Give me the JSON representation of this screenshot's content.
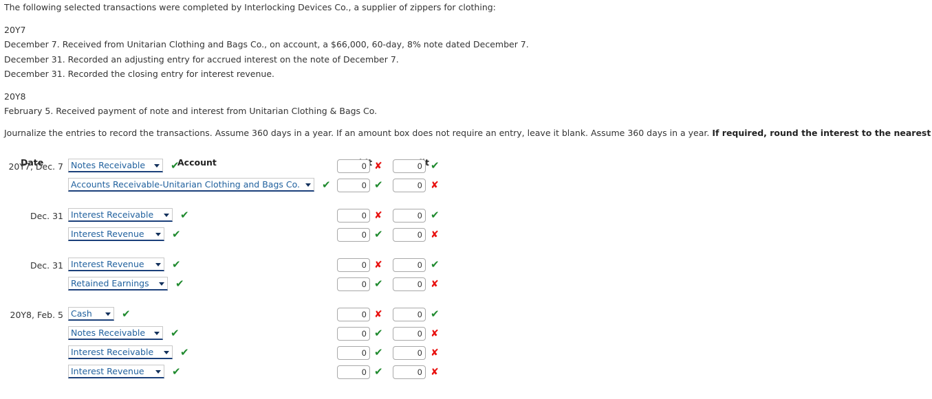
{
  "intro": {
    "lead": "The following selected transactions were completed by Interlocking Devices Co., a supplier of zippers for clothing:",
    "year_1": "20Y7",
    "y1_lines": [
      "December 7. Received from Unitarian Clothing and Bags Co., on account, a $66,000, 60-day, 8% note dated December 7.",
      "December 31. Recorded an adjusting entry for accrued interest on the note of December 7.",
      "December 31. Recorded the closing entry for interest revenue."
    ],
    "year_2": "20Y8",
    "y2_lines": [
      "February 5. Received payment of note and interest from Unitarian Clothing & Bags Co."
    ]
  },
  "instruction": {
    "normal": "Journalize the entries to record the transactions. Assume 360 days in a year. If an amount box does not require an entry, leave it blank. Assume 360 days in a year. ",
    "bold": "If required, round the interest to the nearest cent."
  },
  "headers": {
    "date": "Date",
    "account": "Account",
    "debit": "Debit",
    "credit": "Credit"
  },
  "marks": {
    "correct": "✔",
    "incorrect": "✘"
  },
  "colors": {
    "correct": "#1f8a2e",
    "incorrect": "#e8110f",
    "select_text": "#21619e",
    "select_underline": "#1a3f7a",
    "body_text": "#333333"
  },
  "amount_placeholder": "",
  "groups": [
    {
      "date": "20Y7, Dec. 7",
      "rows": [
        {
          "account": "Notes Receivable",
          "account_width": 138,
          "account_status": "correct",
          "debit_value": "0",
          "debit_status": "incorrect",
          "credit_value": "0",
          "credit_status": "correct"
        },
        {
          "account": "Accounts Receivable-Unitarian Clothing and Bags Co.",
          "account_width": 358,
          "account_status": "correct",
          "debit_value": "0",
          "debit_status": "correct",
          "credit_value": "0",
          "credit_status": "incorrect"
        }
      ]
    },
    {
      "date": "Dec. 31",
      "rows": [
        {
          "account": "Interest Receivable",
          "account_width": 152,
          "account_status": "correct",
          "debit_value": "0",
          "debit_status": "incorrect",
          "credit_value": "0",
          "credit_status": "correct"
        },
        {
          "account": "Interest Revenue",
          "account_width": 140,
          "account_status": "correct",
          "debit_value": "0",
          "debit_status": "correct",
          "credit_value": "0",
          "credit_status": "incorrect"
        }
      ]
    },
    {
      "date": "Dec. 31",
      "rows": [
        {
          "account": "Interest Revenue",
          "account_width": 140,
          "account_status": "correct",
          "debit_value": "0",
          "debit_status": "incorrect",
          "credit_value": "0",
          "credit_status": "correct"
        },
        {
          "account": "Retained Earnings",
          "account_width": 145,
          "account_status": "correct",
          "debit_value": "0",
          "debit_status": "correct",
          "credit_value": "0",
          "credit_status": "incorrect"
        }
      ]
    },
    {
      "date": "20Y8, Feb. 5",
      "rows": [
        {
          "account": "Cash",
          "account_width": 67,
          "account_status": "correct",
          "debit_value": "0",
          "debit_status": "incorrect",
          "credit_value": "0",
          "credit_status": "correct"
        },
        {
          "account": "Notes Receivable",
          "account_width": 138,
          "account_status": "correct",
          "debit_value": "0",
          "debit_status": "correct",
          "credit_value": "0",
          "credit_status": "incorrect"
        },
        {
          "account": "Interest Receivable",
          "account_width": 152,
          "account_status": "correct",
          "debit_value": "0",
          "debit_status": "correct",
          "credit_value": "0",
          "credit_status": "incorrect"
        },
        {
          "account": "Interest Revenue",
          "account_width": 140,
          "account_status": "correct",
          "debit_value": "0",
          "debit_status": "correct",
          "credit_value": "0",
          "credit_status": "incorrect"
        }
      ]
    }
  ]
}
